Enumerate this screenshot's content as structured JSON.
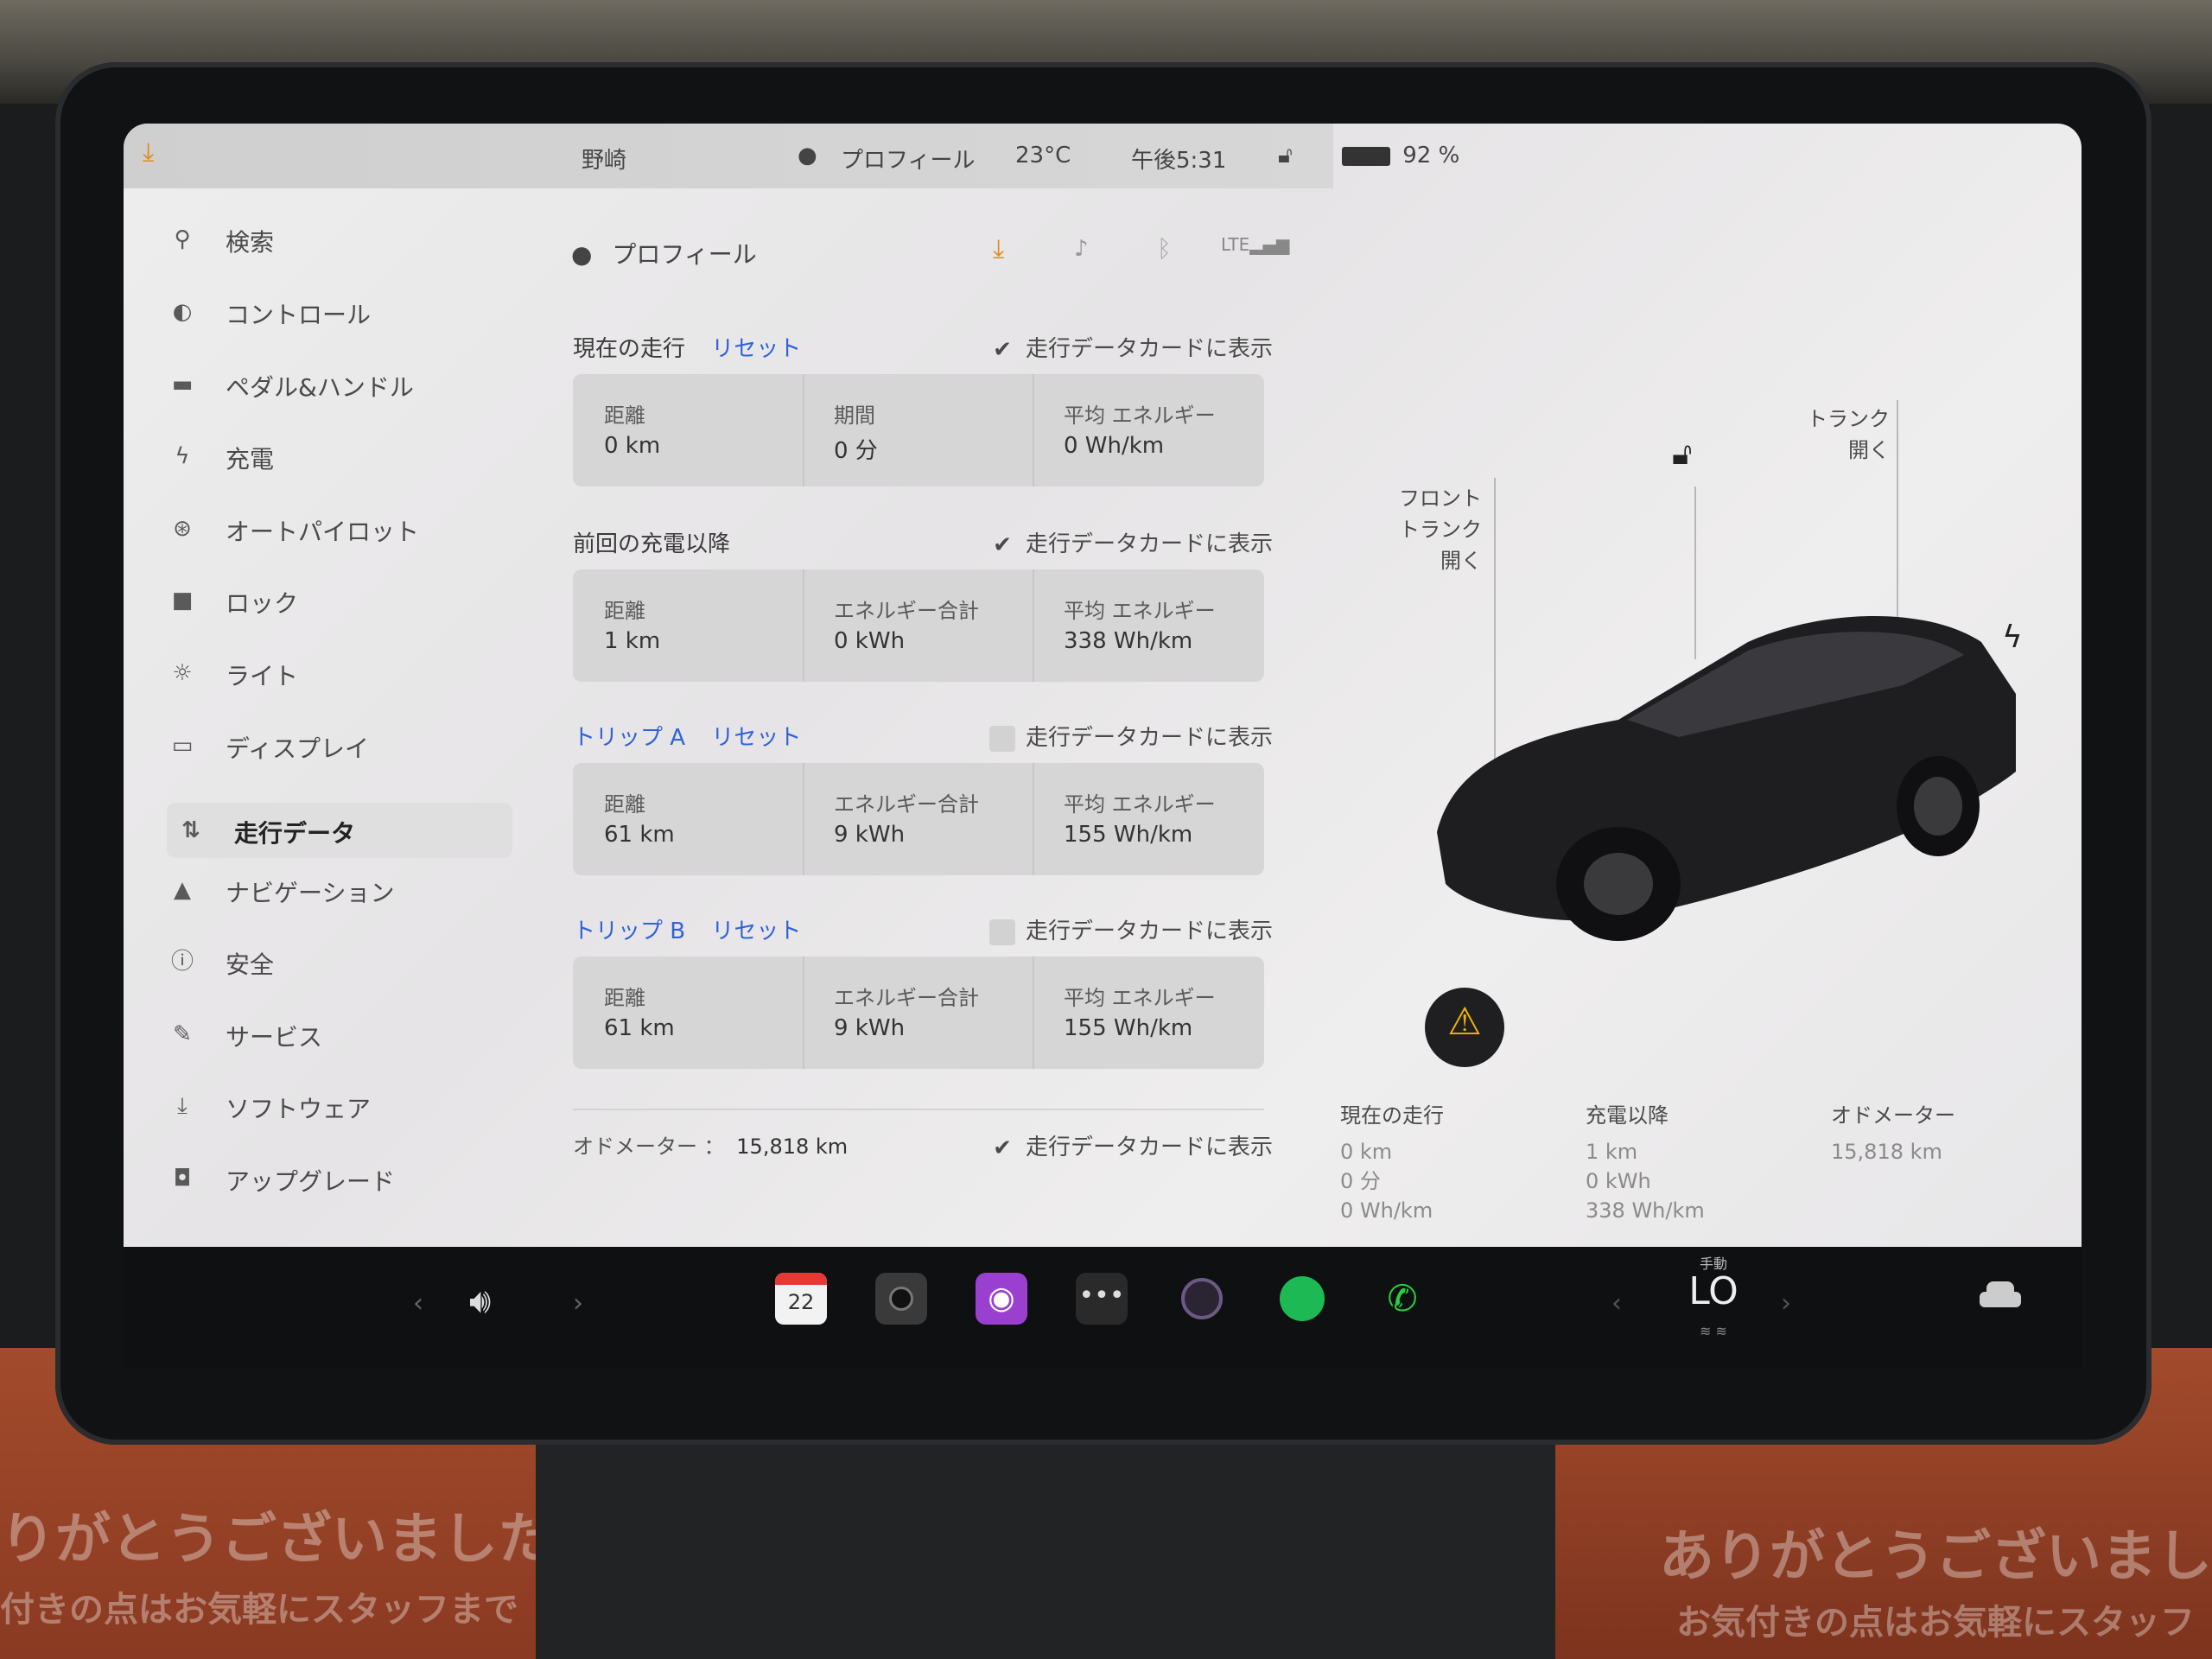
{
  "status_bar": {
    "location": "野崎",
    "profile": "プロフィール",
    "temperature": "23°C",
    "time": "午後5:31",
    "battery": "92 %"
  },
  "header": {
    "profile_label": "プロフィール"
  },
  "sidebar": {
    "items": [
      {
        "label": "検索",
        "icon": "search-icon"
      },
      {
        "label": "コントロール",
        "icon": "toggle-icon"
      },
      {
        "label": "ペダル&ハンドル",
        "icon": "car-icon"
      },
      {
        "label": "充電",
        "icon": "bolt-icon"
      },
      {
        "label": "オートパイロット",
        "icon": "steering-wheel-icon"
      },
      {
        "label": "ロック",
        "icon": "lock-icon"
      },
      {
        "label": "ライト",
        "icon": "sun-icon"
      },
      {
        "label": "ディスプレイ",
        "icon": "display-icon"
      },
      {
        "label": "走行データ",
        "icon": "trips-icon"
      },
      {
        "label": "ナビゲーション",
        "icon": "navigation-icon"
      },
      {
        "label": "安全",
        "icon": "info-circle-icon"
      },
      {
        "label": "サービス",
        "icon": "wrench-icon"
      },
      {
        "label": "ソフトウェア",
        "icon": "download-icon"
      },
      {
        "label": "アップグレード",
        "icon": "bag-icon"
      }
    ],
    "active": "走行データ"
  },
  "checkbox_label": "走行データカードに表示",
  "sections": {
    "current": {
      "title": "現在の走行",
      "reset": "リセット",
      "checked": true,
      "cells": [
        {
          "key": "距離",
          "value": "0 km"
        },
        {
          "key": "期間",
          "value": "0 分"
        },
        {
          "key": "平均 エネルギー",
          "value": "0 Wh/km"
        }
      ]
    },
    "since_charge": {
      "title": "前回の充電以降",
      "checked": true,
      "cells": [
        {
          "key": "距離",
          "value": "1 km"
        },
        {
          "key": "エネルギー合計",
          "value": "0 kWh"
        },
        {
          "key": "平均 エネルギー",
          "value": "338 Wh/km"
        }
      ]
    },
    "trip_a": {
      "title": "トリップ A",
      "reset": "リセット",
      "checked": false,
      "cells": [
        {
          "key": "距離",
          "value": "61 km"
        },
        {
          "key": "エネルギー合計",
          "value": "9 kWh"
        },
        {
          "key": "平均 エネルギー",
          "value": "155 Wh/km"
        }
      ]
    },
    "trip_b": {
      "title": "トリップ B",
      "reset": "リセット",
      "checked": false,
      "cells": [
        {
          "key": "距離",
          "value": "61 km"
        },
        {
          "key": "エネルギー合計",
          "value": "9 kWh"
        },
        {
          "key": "平均 エネルギー",
          "value": "155 Wh/km"
        }
      ]
    }
  },
  "odometer": {
    "label": "オドメーター ：",
    "value": "15,818 km",
    "checked": true
  },
  "car_panel": {
    "front_trunk": [
      "フロント",
      "トランク",
      "開く"
    ],
    "trunk": [
      "トランク",
      "開く"
    ]
  },
  "summary": {
    "current": {
      "title": "現在の走行",
      "lines": [
        "0 km",
        "0 分",
        "0 Wh/km"
      ]
    },
    "since_charge": {
      "title": "充電以降",
      "lines": [
        "1 km",
        "0 kWh",
        "338 Wh/km"
      ]
    },
    "odometer": {
      "title": "オドメーター",
      "lines": [
        "15,818 km"
      ]
    }
  },
  "dock": {
    "calendar_day": "22",
    "climate_mode": "手動",
    "climate_value": "LO"
  },
  "mat_text": {
    "left_line1": "りがとうございました",
    "left_line2": "付きの点はお気軽にスタッフまで",
    "right_line1": "ありがとうございました",
    "right_line2": "お気付きの点はお気軽にスタッフ"
  },
  "colors": {
    "accent_blue": "#2f63d6",
    "download_orange": "#e08a1e",
    "spotify_green": "#1db954",
    "phone_green": "#2ecc40",
    "podcast_purple": "#9b3fd1"
  }
}
